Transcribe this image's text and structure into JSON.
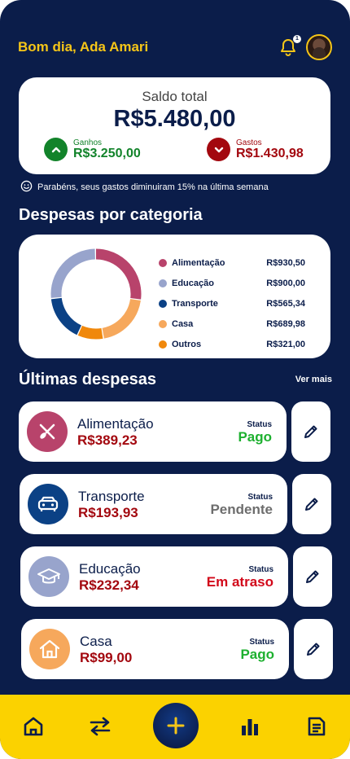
{
  "header": {
    "greeting": "Bom dia, Ada Amari",
    "notification_count": "1",
    "icons": [
      "bell-icon",
      "avatar"
    ]
  },
  "balance": {
    "label": "Saldo total",
    "value": "R$5.480,00",
    "gains": {
      "label": "Ganhos",
      "value": "R$3.250,00",
      "icon": "chevron-up-icon"
    },
    "expenses": {
      "label": "Gastos",
      "value": "R$1.430,98",
      "icon": "chevron-down-icon"
    }
  },
  "notice": {
    "text": "Parabéns, seus gastos diminuiram 15% na última semana",
    "icon": "smile-icon"
  },
  "categories": {
    "title": "Despesas por categoria",
    "items": [
      {
        "name": "Alimentação",
        "value": "R$930,50",
        "color": "#b8436b"
      },
      {
        "name": "Educação",
        "value": "R$900,00",
        "color": "#98a4cc"
      },
      {
        "name": "Transporte",
        "value": "R$565,34",
        "color": "#0b4185"
      },
      {
        "name": "Casa",
        "value": "R$689,98",
        "color": "#f6a85c"
      },
      {
        "name": "Outros",
        "value": "R$321,00",
        "color": "#f0880c"
      }
    ]
  },
  "chart_data": {
    "type": "pie",
    "categories": [
      "Alimentação",
      "Educação",
      "Transporte",
      "Casa",
      "Outros"
    ],
    "values": [
      930.5,
      900.0,
      565.34,
      689.98,
      321.0
    ],
    "colors": [
      "#b8436b",
      "#98a4cc",
      "#0b4185",
      "#f6a85c",
      "#f0880c"
    ]
  },
  "latest": {
    "title": "Últimas despesas",
    "see_more": "Ver mais",
    "status_label": "Status",
    "items": [
      {
        "name": "Alimentação",
        "amount": "R$389,23",
        "status": "Pago",
        "icon": "cutlery-icon",
        "color": "#b8436b"
      },
      {
        "name": "Transporte",
        "amount": "R$193,93",
        "status": "Pendente",
        "icon": "car-icon",
        "color": "#0b4185"
      },
      {
        "name": "Educação",
        "amount": "R$232,34",
        "status": "Em atraso",
        "icon": "graduation-cap-icon",
        "color": "#98a4cc"
      },
      {
        "name": "Casa",
        "amount": "R$99,00",
        "status": "Pago",
        "icon": "house-icon",
        "color": "#f6a85c"
      }
    ]
  },
  "nav": {
    "items": [
      "home-icon",
      "transfer-icon",
      "plus-icon",
      "bar-chart-icon",
      "document-icon"
    ]
  }
}
